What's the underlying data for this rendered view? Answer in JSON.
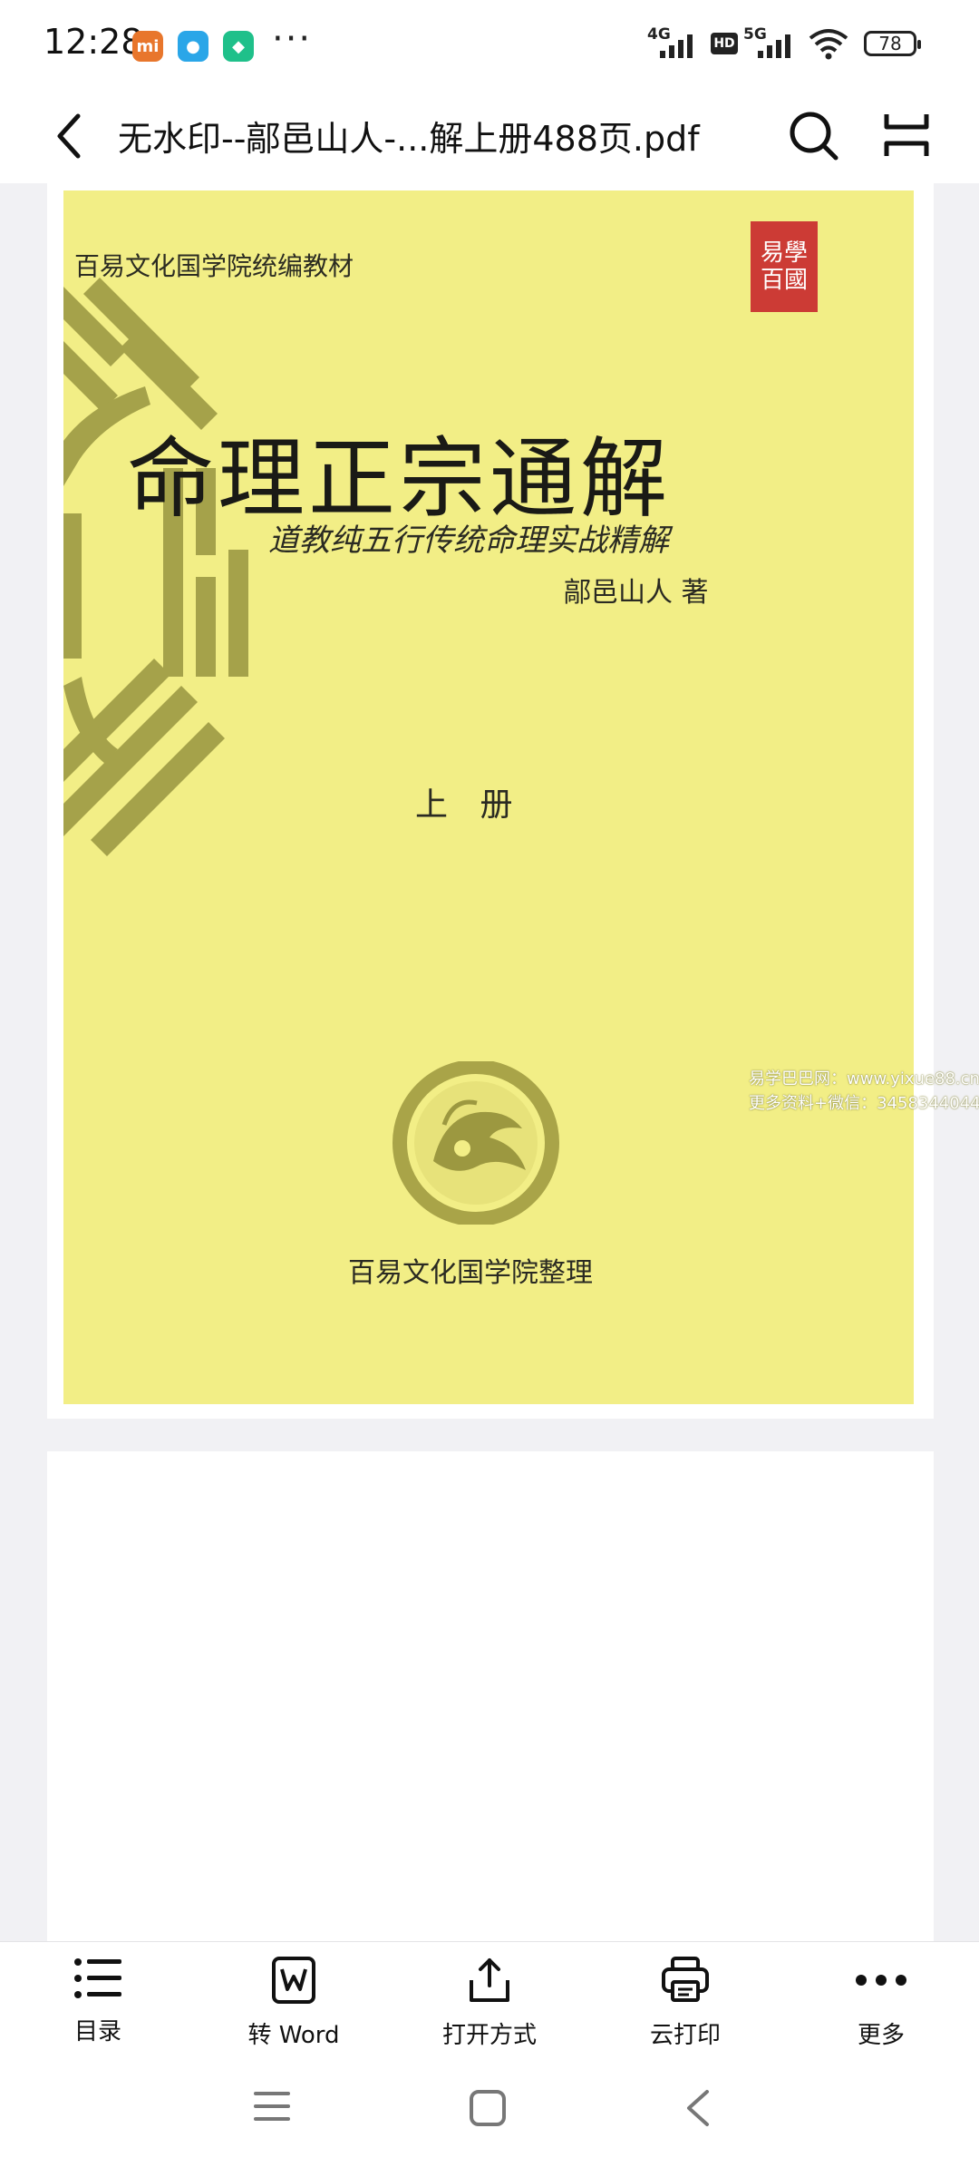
{
  "status_bar": {
    "time": "12:28",
    "net1": "4G",
    "hd": "HD",
    "net2": "5G",
    "battery": "78"
  },
  "header": {
    "title": "无水印--鄗邑山人-...解上册488页.pdf"
  },
  "cover": {
    "series": "百易文化国学院统编教材",
    "seal_top": "易學",
    "seal_bottom": "百國",
    "title": "命理正宗通解",
    "subtitle": "道教纯五行传统命理实战精解",
    "author": "鄗邑山人 著",
    "volume": "上 册",
    "publisher": "百易文化国学院整理"
  },
  "watermark": {
    "line1": "易学巴巴网：www.yixue88.cn",
    "line2": "更多资料+微信：3458344044"
  },
  "toolbar": {
    "toc": "目录",
    "to_word": "转 Word",
    "open_with": "打开方式",
    "cloud_print": "云打印",
    "more": "更多"
  },
  "colors": {
    "cover_bg": "#f2ee86",
    "seal": "#cc3b35",
    "bagua": "#a5a24a"
  }
}
